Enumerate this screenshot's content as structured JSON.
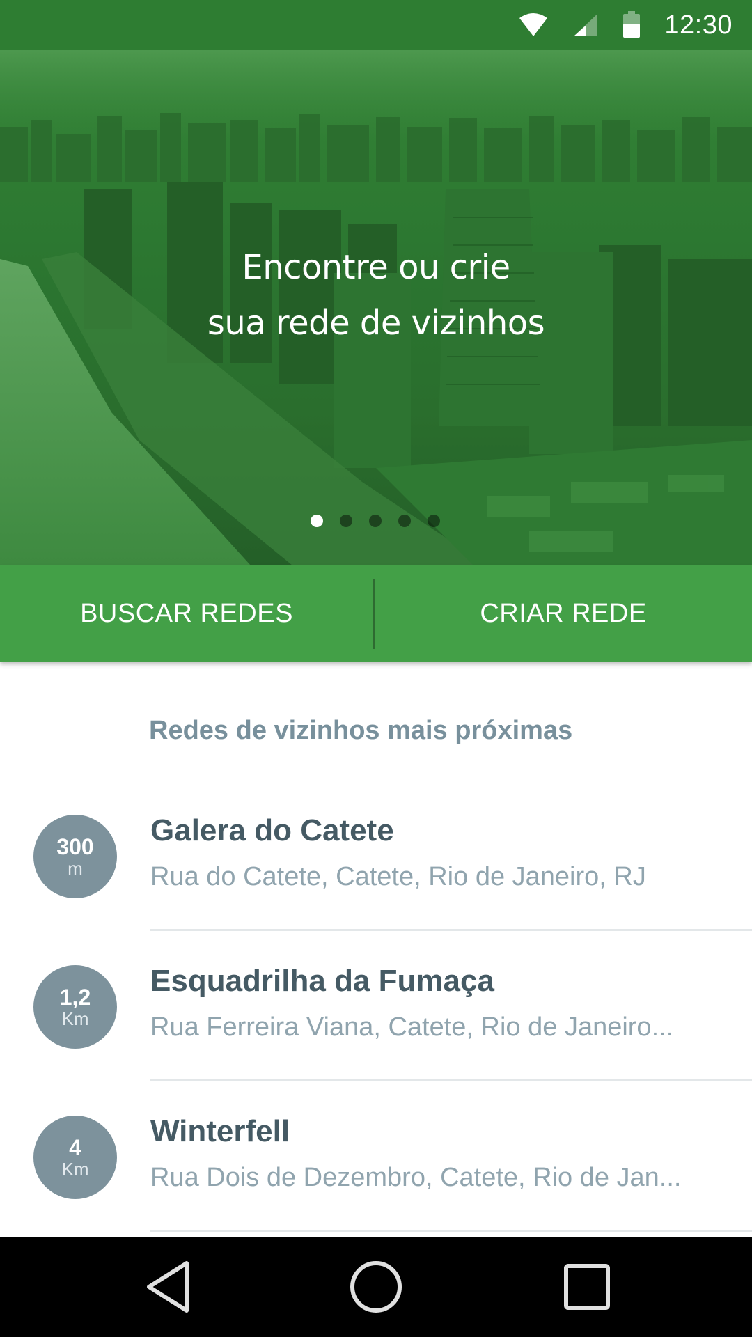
{
  "status_bar": {
    "time": "12:30",
    "icons": [
      "wifi-icon",
      "signal-icon",
      "battery-icon"
    ]
  },
  "hero": {
    "title_line1": "Encontre ou crie",
    "title_line2": "sua rede de vizinhos",
    "pager": {
      "count": 5,
      "active_index": 0
    }
  },
  "actions": {
    "search_label": "BUSCAR REDES",
    "create_label": "CRIAR REDE"
  },
  "list": {
    "section_title": "Redes de vizinhos mais próximas",
    "items": [
      {
        "distance": "300",
        "unit": "m",
        "name": "Galera do Catete",
        "address": "Rua do Catete, Catete, Rio de Janeiro, RJ"
      },
      {
        "distance": "1,2",
        "unit": "Km",
        "name": "Esquadrilha da Fumaça",
        "address": "Rua Ferreira Viana, Catete, Rio de Janeiro..."
      },
      {
        "distance": "4",
        "unit": "Km",
        "name": "Winterfell",
        "address": "Rua Dois de Dezembro, Catete, Rio de Jan..."
      }
    ]
  },
  "nav_bar": {
    "buttons": [
      "back-icon",
      "home-icon",
      "recents-icon"
    ]
  },
  "colors": {
    "primary_dark": "#2e7d32",
    "primary": "#43a047",
    "badge": "#7d929c",
    "title_text": "#455a64",
    "sub_text": "#90a4ae"
  }
}
